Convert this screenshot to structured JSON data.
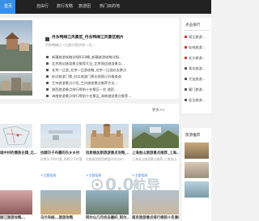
{
  "nav": {
    "items": [
      "首页",
      "自由行",
      "旅行攻略",
      "旅游团",
      "热门目的地"
    ],
    "active_index": 0
  },
  "featured": {
    "title": "丹东鸭绿江风景区_丹东鸭绿江风景区图片",
    "desc": "丹东鸭绿江一日游介绍|丹东一日...",
    "list": [
      "新疆旅游攻略详细9天8晚_新疆旅游攻略详细...",
      "北京周边旅游景点推荐大全_北京周边旅游景点...",
      "北京一日游_北京一日游攻略_北京一日游必去景点",
      "虹口旅游门票_虹口旅游门票在线预订价格查询",
      "兰州旅游景点介绍_兰州旅游景点推荐大全...",
      "湘西旅游景点排行榜前十名景区一览 湘西...",
      "海南旅游景点排行榜前十名景区_海南旅游景点推荐..."
    ]
  },
  "sidebar": {
    "title": "点击排行",
    "items": [
      "丽江旅游...",
      "桂林旅游...",
      "长沙旅游...",
      "青岛旅游...",
      "大连旅游...",
      "厦门旅游...",
      "延吉旅游..."
    ],
    "highlight_count": 3
  },
  "more_label": "更多>>",
  "cards_row1": [
    {
      "title": "城中村的傣族古镇_北...",
      "sub": "...",
      "tag": ""
    },
    {
      "title": "抗戟尕子布晨的乐乡乡村",
      "sub": "抗戟尕子的村落_抗戟尕子村落...",
      "tag": "+主题相册"
    },
    {
      "title": "拉斯维加斯旅游景点攻略_...",
      "sub": "拉斯维加斯是美国内华达州...",
      "tag": "+主题相册"
    },
    {
      "title": "上海金山旅游景点推荐_上海...",
      "sub": "上海金山旅游景点推荐_上海金山...",
      "tag": "+主题相册"
    }
  ],
  "cards_row2": [
    {
      "title": "丽江旅游攻略..."
    },
    {
      "title": "乌兰布统...旅游攻略"
    },
    {
      "title": "阿尔山几月份去最好_阿尔..."
    },
    {
      "title": "南京旅游景点排行榜前十名景区..."
    }
  ],
  "sidebar2_title": "旅游推荐"
}
